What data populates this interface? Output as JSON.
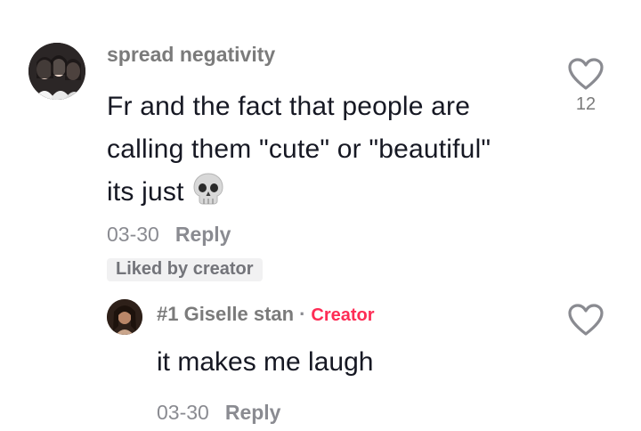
{
  "comment": {
    "username": "spread negativity",
    "text_line1": "Fr and the fact that people are",
    "text_line2": "calling them \"cute\" or \"beautiful\"",
    "text_line3": "its just",
    "emoji_icon": "skull-icon",
    "date": "03-30",
    "reply_label": "Reply",
    "liked_badge": "Liked by creator",
    "like_count": "12"
  },
  "reply": {
    "username": "#1 Giselle stan",
    "separator": "·",
    "creator_badge": "Creator",
    "text": "it makes me laugh",
    "date": "03-30",
    "reply_label": "Reply"
  },
  "colors": {
    "accent": "#fe2c55",
    "text": "#161823",
    "muted": "#8a8b91"
  }
}
